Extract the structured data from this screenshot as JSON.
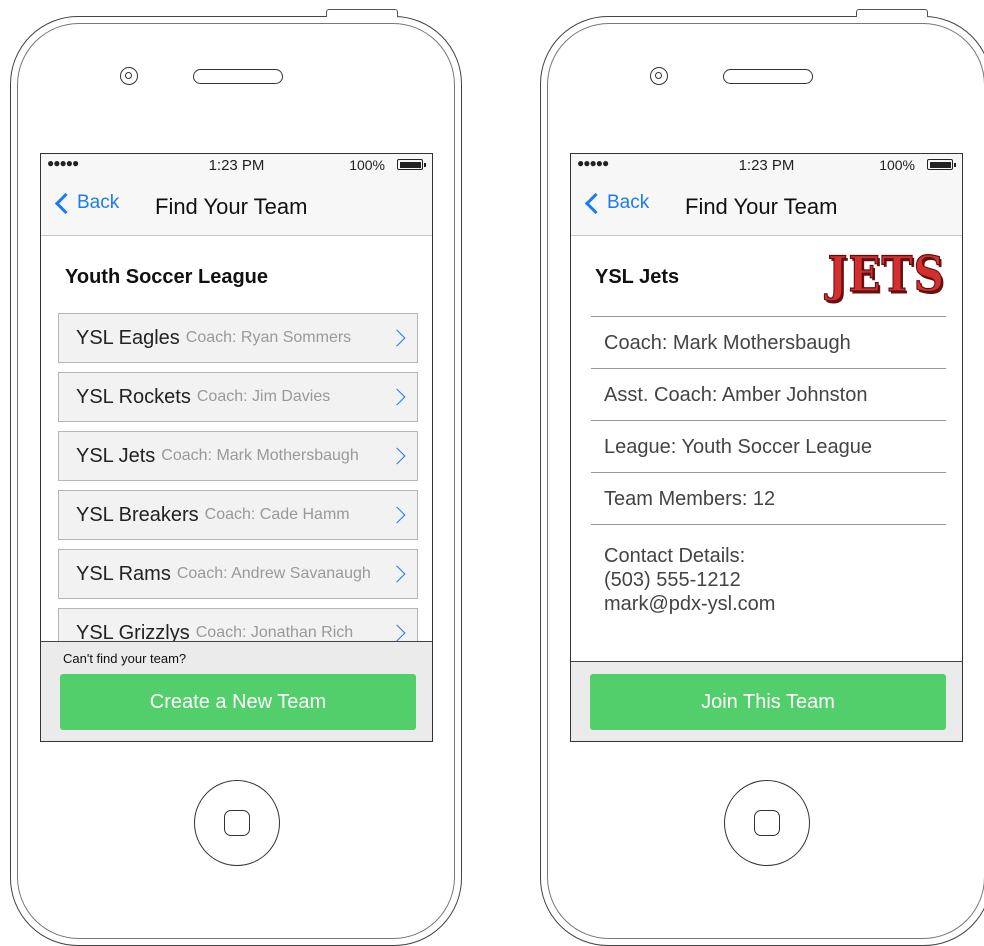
{
  "status_bar": {
    "signal": "●●●●●",
    "time": "1:23 PM",
    "battery": "100%"
  },
  "nav": {
    "back_label": "Back",
    "title": "Find Your Team"
  },
  "list_screen": {
    "section_title": "Youth Soccer League",
    "teams": [
      {
        "name": "YSL Eagles",
        "coach": "Coach: Ryan Sommers"
      },
      {
        "name": "YSL Rockets",
        "coach": "Coach: Jim Davies"
      },
      {
        "name": "YSL Jets",
        "coach": "Coach: Mark Mothersbaugh"
      },
      {
        "name": "YSL Breakers",
        "coach": "Coach: Cade Hamm"
      },
      {
        "name": "YSL Rams",
        "coach": "Coach: Andrew Savanaugh"
      },
      {
        "name": "YSL Grizzlys",
        "coach": "Coach: Jonathan Rich"
      }
    ],
    "footer_prompt": "Can't find your team?",
    "create_button": "Create a New Team"
  },
  "detail_screen": {
    "team_name": "YSL Jets",
    "logo_text": "JETS",
    "coach": "Coach: Mark Mothersbaugh",
    "asst_coach": "Asst. Coach: Amber Johnston",
    "league": "League: Youth Soccer League",
    "members": "Team Members: 12",
    "contact_label": "Contact Details:",
    "contact_phone": "(503) 555-1212",
    "contact_email": "mark@pdx-ysl.com",
    "join_button": "Join This Team"
  },
  "colors": {
    "accent": "#1a7cf2",
    "primary_button": "#52cf6a",
    "logo_red": "#d32f2f"
  }
}
